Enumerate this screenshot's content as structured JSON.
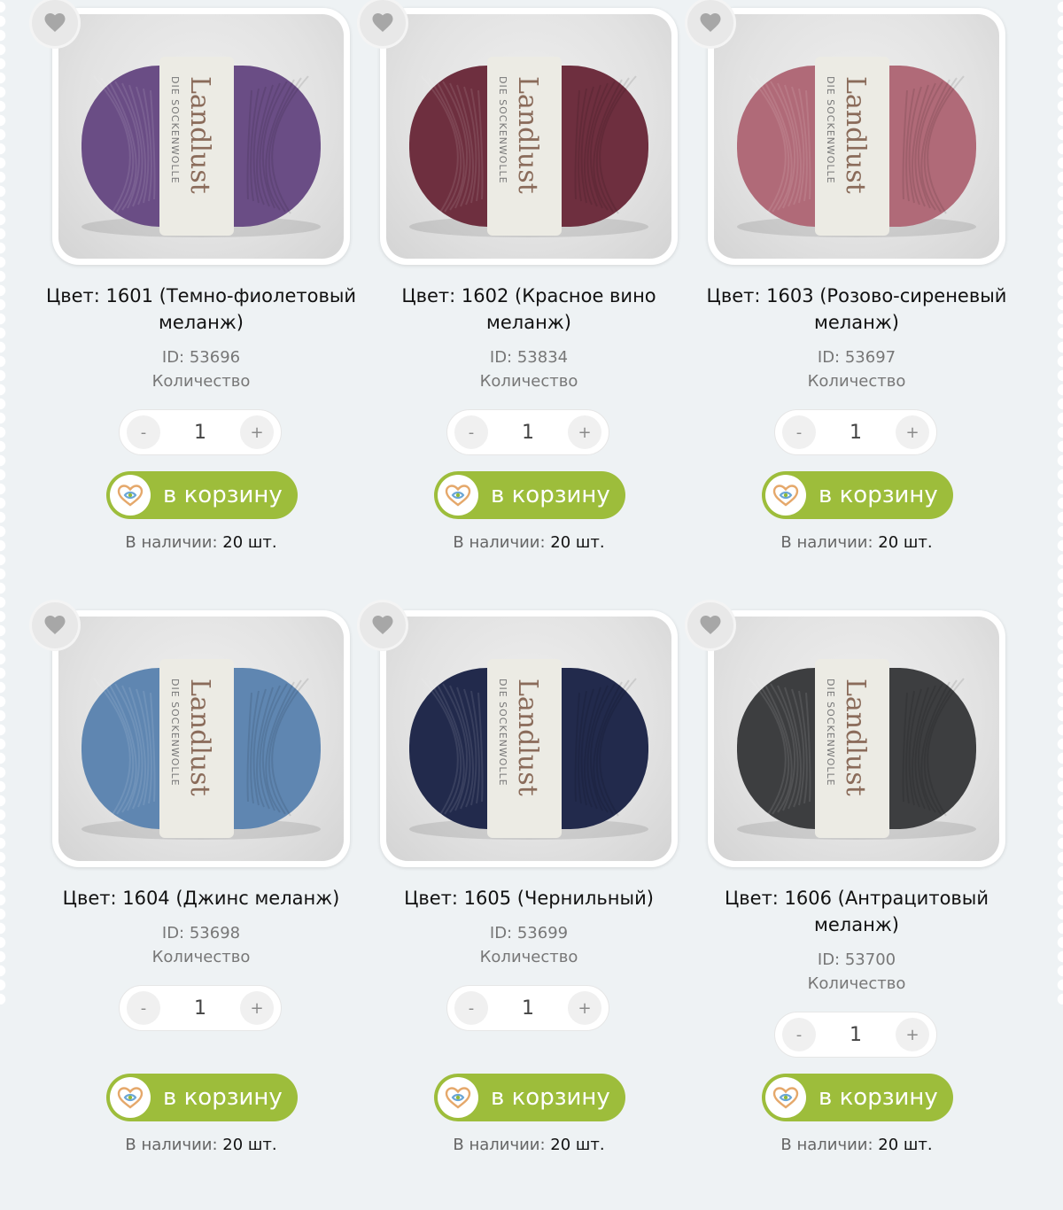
{
  "products": [
    {
      "title": "Цвет: 1601 (Темно-фиолетовый меланж)",
      "id": "ID: 53696",
      "qty_label": "Количество",
      "qty": "1",
      "cart": "в корзину",
      "stock_label": "В наличии:",
      "stock_value": "20 шт.",
      "yarn_color": "#6a4d85"
    },
    {
      "title": "Цвет: 1602 (Красное вино меланж)",
      "id": "ID: 53834",
      "qty_label": "Количество",
      "qty": "1",
      "cart": "в корзину",
      "stock_label": "В наличии:",
      "stock_value": "20 шт.",
      "yarn_color": "#6e2f3f"
    },
    {
      "title": "Цвет: 1603 (Розово-сиреневый меланж)",
      "id": "ID: 53697",
      "qty_label": "Количество",
      "qty": "1",
      "cart": "в корзину",
      "stock_label": "В наличии:",
      "stock_value": "20 шт.",
      "yarn_color": "#b06a78"
    },
    {
      "title": "Цвет: 1604 (Джинс меланж)",
      "id": "ID: 53698",
      "qty_label": "Количество",
      "qty": "1",
      "cart": "в корзину",
      "stock_label": "В наличии:",
      "stock_value": "20 шт.",
      "yarn_color": "#5f86b1"
    },
    {
      "title": "Цвет: 1605 (Чернильный)",
      "id": "ID: 53699",
      "qty_label": "Количество",
      "qty": "1",
      "cart": "в корзину",
      "stock_label": "В наличии:",
      "stock_value": "20 шт.",
      "yarn_color": "#222a4c"
    },
    {
      "title": "Цвет: 1606 (Антрацитовый меланж)",
      "id": "ID: 53700",
      "qty_label": "Количество",
      "qty": "1",
      "cart": "в корзину",
      "stock_label": "В наличии:",
      "stock_value": "20 шт.",
      "yarn_color": "#3d3e40"
    }
  ],
  "stepper": {
    "minus": "-",
    "plus": "+"
  },
  "label_brand": "Landlust",
  "label_sub": "DIE SOCKENWOLLE",
  "accent_color": "#9dbd3b",
  "icons": {
    "favorite": "heart-icon",
    "cart_logo": "yarn-heart-logo-icon"
  }
}
